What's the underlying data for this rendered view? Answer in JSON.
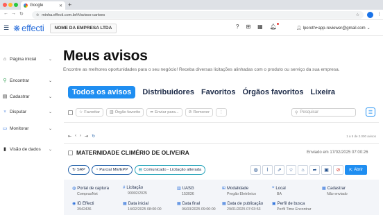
{
  "browser": {
    "tab_title": "Google",
    "url": "minha.effecti.com.br/#/avisos-cartoes"
  },
  "header": {
    "logo_text": "effecti",
    "company": "NOME DA EMPRESA LTDA",
    "user_email": "lporoth+app-reviewer@gmail.com"
  },
  "sidebar": {
    "items": [
      {
        "label": "Página inicial",
        "icon": "home-icon"
      },
      {
        "label": "Encontrar",
        "icon": "search-icon"
      },
      {
        "label": "Cadastrar",
        "icon": "clipboard-icon"
      },
      {
        "label": "Disputar",
        "icon": "trophy-icon"
      },
      {
        "label": "Monitorar",
        "icon": "monitor-icon"
      },
      {
        "label": "Visão de dados",
        "icon": "bar-chart-icon"
      }
    ]
  },
  "main": {
    "title": "Meus avisos",
    "subtitle": "Encontre as melhores oportunidades para o seu negócio! Receba diversas licitações alinhadas com o produto ou serviço da sua empresa.",
    "tabs": [
      {
        "label": "Todos os avisos",
        "active": true
      },
      {
        "label": "Distribuidores",
        "active": false
      },
      {
        "label": "Favoritos",
        "active": false
      },
      {
        "label": "Órgãos favoritos",
        "active": false
      },
      {
        "label": "Lixeira",
        "active": false
      }
    ],
    "toolbar": {
      "favorite": "Favoritar",
      "fav_agency": "Órgão favorito",
      "send": "Enviar para...",
      "remove": "Remover",
      "search_placeholder": "Pesquisar"
    },
    "pager_count": "1 a 5 de 2.000 avisos",
    "card": {
      "title": "MATERNIDADE CLIMÉRIO DE OLIVEIRA",
      "sent": "Enviado em 17/02/2025 07:00:26",
      "chips": [
        "SRP",
        "Parcial ME/EPP",
        "Comunicado - Licitação alterada"
      ],
      "open_label": "Abrir",
      "fields": [
        {
          "label": "Portal de captura",
          "value": "ComprasNet",
          "icon": "globe-icon"
        },
        {
          "label": "Licitação",
          "value": "90002/2025",
          "icon": "hash-icon"
        },
        {
          "label": "UASG",
          "value": "153036",
          "icon": "building-icon"
        },
        {
          "label": "Modalidade",
          "value": "Pregão Eletrônico",
          "icon": "hierarchy-icon"
        },
        {
          "label": "Local",
          "value": "BA",
          "icon": "pin-icon"
        },
        {
          "label": "Cadastrar",
          "value": "Não enviado",
          "icon": "calendar-icon"
        },
        {
          "label": "ID Effecti",
          "value": "3942436",
          "icon": "id-icon"
        },
        {
          "label": "Data inicial",
          "value": "14/02/2025 08:00:00",
          "icon": "calendar-icon"
        },
        {
          "label": "Data final",
          "value": "06/03/2025 09:00:00",
          "icon": "calendar-icon"
        },
        {
          "label": "Data de publicação",
          "value": "29/01/2025 07:03:53",
          "icon": "calendar-icon"
        },
        {
          "label": "Perfil de busca",
          "value": "Perfil Time Encontrar",
          "icon": "profile-icon"
        }
      ]
    }
  },
  "colors": {
    "accent": "#1f8ef1",
    "brand": "#2a6fdb",
    "text_dark": "#1f2d4a"
  }
}
